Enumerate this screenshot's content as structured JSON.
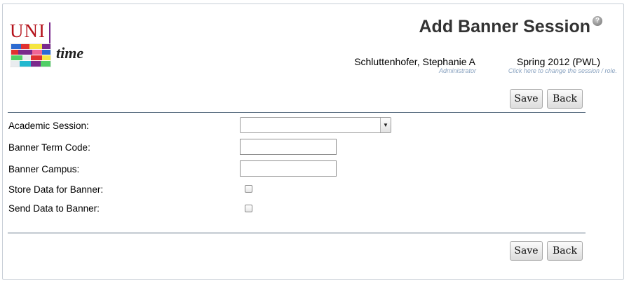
{
  "header": {
    "logo_uni": "UNI",
    "logo_time": "time",
    "title": "Add Banner Session",
    "help_glyph": "?",
    "user_name": "Schluttenhofer, Stephanie A",
    "user_role": "Administrator",
    "session_name": "Spring 2012 (PWL)",
    "session_hint": "Click here to change the session / role."
  },
  "buttons": {
    "save": "Save",
    "back": "Back"
  },
  "form": {
    "academic_session": {
      "label": "Academic Session:",
      "value": ""
    },
    "banner_term_code": {
      "label": "Banner Term Code:",
      "value": ""
    },
    "banner_campus": {
      "label": "Banner Campus:",
      "value": ""
    },
    "store_data": {
      "label": "Store Data for Banner:",
      "checked": false
    },
    "send_data": {
      "label": "Send Data to Banner:",
      "checked": false
    }
  },
  "colors": {
    "logo_red": "#b5121b",
    "hint_blue": "#8aa3c0",
    "rule": "#5b6f82"
  }
}
